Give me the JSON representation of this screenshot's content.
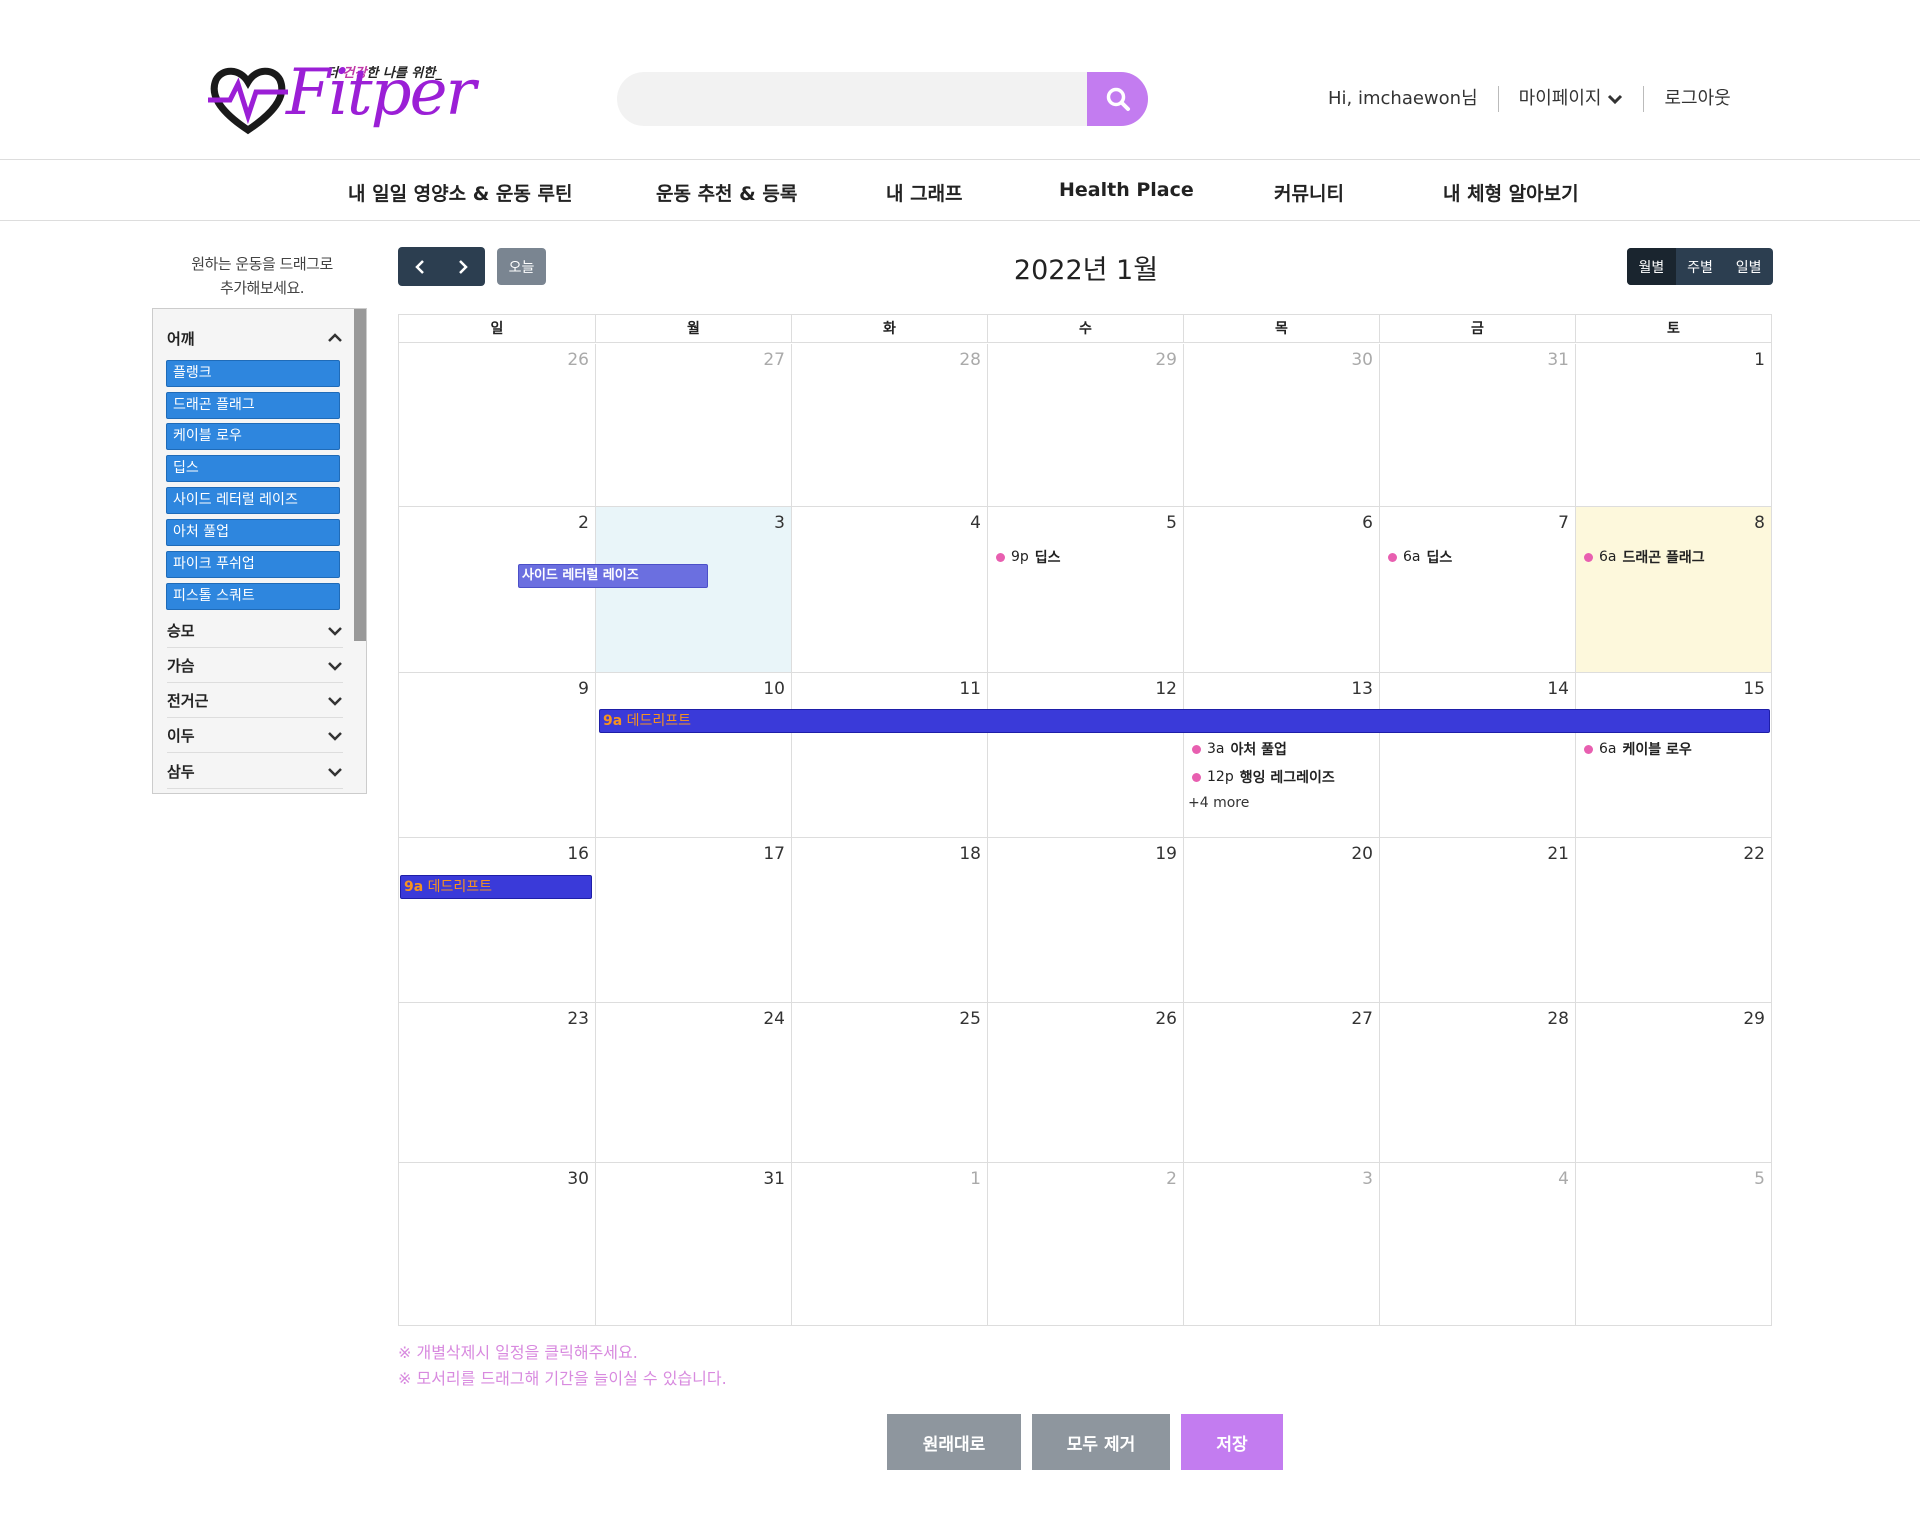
{
  "logo": {
    "text": "Fitper",
    "tagline_pre": "더 ",
    "tagline_hl": "건강",
    "tagline_post": "한 나를 위한_"
  },
  "search": {
    "placeholder": ""
  },
  "user_menu": {
    "greeting": "Hi, imchaewon님",
    "mypage": "마이페이지",
    "logout": "로그아웃"
  },
  "nav": [
    "내 일일 영양소 & 운동 루틴",
    "운동 추천 & 등록",
    "내 그래프",
    "Health Place",
    "커뮤니티",
    "내 체형 알아보기"
  ],
  "sidebar": {
    "hint_line1": "원하는 운동을 드래그로",
    "hint_line2": "추가해보세요.",
    "groups": [
      {
        "label": "어깨",
        "expanded": true,
        "items": [
          "플랭크",
          "드래곤 플래그",
          "케이블 로우",
          "딥스",
          "사이드 레터럴 레이즈",
          "아처 풀업",
          "파이크 푸쉬업",
          "피스톨 스쿼트"
        ]
      },
      {
        "label": "승모",
        "expanded": false
      },
      {
        "label": "가슴",
        "expanded": false
      },
      {
        "label": "전거근",
        "expanded": false
      },
      {
        "label": "이두",
        "expanded": false
      },
      {
        "label": "삼두",
        "expanded": false
      }
    ]
  },
  "toolbar": {
    "today": "오늘",
    "title": "2022년 1월",
    "views": [
      "월별",
      "주별",
      "일별"
    ],
    "active_view": "월별"
  },
  "weekdays": [
    "일",
    "월",
    "화",
    "수",
    "목",
    "금",
    "토"
  ],
  "weeks": [
    [
      {
        "d": "26",
        "o": true
      },
      {
        "d": "27",
        "o": true
      },
      {
        "d": "28",
        "o": true
      },
      {
        "d": "29",
        "o": true
      },
      {
        "d": "30",
        "o": true
      },
      {
        "d": "31",
        "o": true
      },
      {
        "d": "1"
      }
    ],
    [
      {
        "d": "2"
      },
      {
        "d": "3",
        "sel": true
      },
      {
        "d": "4"
      },
      {
        "d": "5"
      },
      {
        "d": "6"
      },
      {
        "d": "7"
      },
      {
        "d": "8",
        "today": true
      }
    ],
    [
      {
        "d": "9"
      },
      {
        "d": "10"
      },
      {
        "d": "11"
      },
      {
        "d": "12"
      },
      {
        "d": "13"
      },
      {
        "d": "14"
      },
      {
        "d": "15"
      }
    ],
    [
      {
        "d": "16"
      },
      {
        "d": "17"
      },
      {
        "d": "18"
      },
      {
        "d": "19"
      },
      {
        "d": "20"
      },
      {
        "d": "21"
      },
      {
        "d": "22"
      }
    ],
    [
      {
        "d": "23"
      },
      {
        "d": "24"
      },
      {
        "d": "25"
      },
      {
        "d": "26"
      },
      {
        "d": "27"
      },
      {
        "d": "28"
      },
      {
        "d": "29"
      }
    ],
    [
      {
        "d": "30"
      },
      {
        "d": "31"
      },
      {
        "d": "1",
        "o": true
      },
      {
        "d": "2",
        "o": true
      },
      {
        "d": "3",
        "o": true
      },
      {
        "d": "4",
        "o": true
      },
      {
        "d": "5",
        "o": true
      }
    ]
  ],
  "events": {
    "jan5": {
      "time": "9p",
      "title": "딥스"
    },
    "jan7": {
      "time": "6a",
      "title": "딥스"
    },
    "jan8": {
      "time": "6a",
      "title": "드래곤 플래그"
    },
    "jan13a": {
      "time": "3a",
      "title": "아처 풀업"
    },
    "jan13b": {
      "time": "12p",
      "title": "행잉 레그레이즈"
    },
    "jan13_more": "+4 more",
    "jan15": {
      "time": "6a",
      "title": "케이블 로우"
    },
    "drag_bar": {
      "title": "사이드 레터럴 레이즈"
    },
    "deadlift_w3": {
      "time": "9a",
      "title": "데드리프트"
    },
    "deadlift_w4": {
      "time": "9a",
      "title": "데드리프트"
    }
  },
  "notes": [
    "※ 개별삭제시 일정을 클릭해주세요.",
    "※ 모서리를 드래그해 기간을 늘이실 수 있습니다."
  ],
  "actions": {
    "reset": "원래대로",
    "clear": "모두 제거",
    "save": "저장"
  },
  "colors": {
    "accent": "#c37cf0",
    "event_blue": "#3a3ad9",
    "drag_purple": "#6b6fe0",
    "dot_pink": "#e85fb0",
    "today_bg": "#fdf8dc"
  }
}
